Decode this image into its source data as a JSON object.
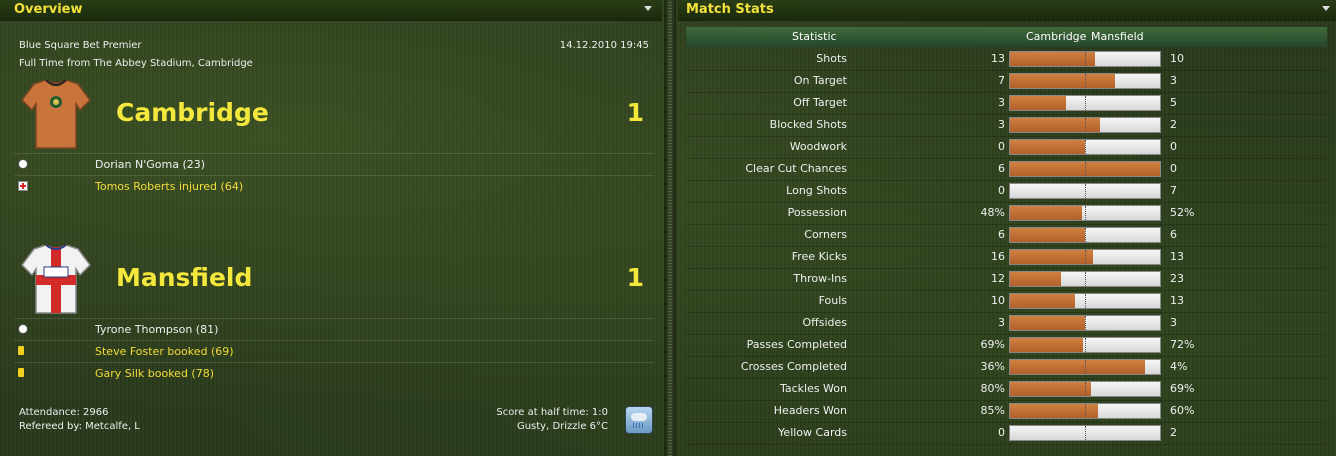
{
  "overview": {
    "title": "Overview",
    "competition": "Blue Square Bet Premier",
    "datetime": "14.12.2010 19:45",
    "subtitle": "Full Time from The Abbey Stadium, Cambridge",
    "home": {
      "name": "Cambridge",
      "score": "1",
      "shirt_color": "#c8743a",
      "events": [
        {
          "type": "goal",
          "text": "Dorian N'Goma (23)"
        },
        {
          "type": "injury",
          "text": "Tomos Roberts injured (64)"
        }
      ]
    },
    "away": {
      "name": "Mansfield",
      "score": "1",
      "shirt_color": "#f2f2f2",
      "events": [
        {
          "type": "goal",
          "text": "Tyrone Thompson (81)"
        },
        {
          "type": "yellow",
          "text": "Steve Foster booked (69)"
        },
        {
          "type": "yellow",
          "text": "Gary Silk booked (78)"
        }
      ]
    },
    "attendance": "Attendance: 2966",
    "referee": "Refereed by: Metcalfe, L",
    "half_time": "Score at half time: 1:0",
    "weather": "Gusty, Drizzle 6°C",
    "weather_icon": "drizzle-icon"
  },
  "stats": {
    "title": "Match Stats",
    "head_statistic": "Statistic",
    "head_home": "Cambridge",
    "head_away": "Mansfield",
    "colors": {
      "home": "#c06e34",
      "away": "#e6e6e6"
    },
    "rows": [
      {
        "label": "Shots",
        "home": "13",
        "away": "10",
        "home_share": 0.565
      },
      {
        "label": "On Target",
        "home": "7",
        "away": "3",
        "home_share": 0.7
      },
      {
        "label": "Off Target",
        "home": "3",
        "away": "5",
        "home_share": 0.375
      },
      {
        "label": "Blocked Shots",
        "home": "3",
        "away": "2",
        "home_share": 0.6
      },
      {
        "label": "Woodwork",
        "home": "0",
        "away": "0",
        "home_share": 0.5
      },
      {
        "label": "Clear Cut Chances",
        "home": "6",
        "away": "0",
        "home_share": 1.0
      },
      {
        "label": "Long Shots",
        "home": "0",
        "away": "7",
        "home_share": 0.0
      },
      {
        "label": "Possession",
        "home": "48%",
        "away": "52%",
        "home_share": 0.48
      },
      {
        "label": "Corners",
        "home": "6",
        "away": "6",
        "home_share": 0.5
      },
      {
        "label": "Free Kicks",
        "home": "16",
        "away": "13",
        "home_share": 0.552
      },
      {
        "label": "Throw-Ins",
        "home": "12",
        "away": "23",
        "home_share": 0.343
      },
      {
        "label": "Fouls",
        "home": "10",
        "away": "13",
        "home_share": 0.435
      },
      {
        "label": "Offsides",
        "home": "3",
        "away": "3",
        "home_share": 0.5
      },
      {
        "label": "Passes Completed",
        "home": "69%",
        "away": "72%",
        "home_share": 0.489
      },
      {
        "label": "Crosses Completed",
        "home": "36%",
        "away": "4%",
        "home_share": 0.9
      },
      {
        "label": "Tackles Won",
        "home": "80%",
        "away": "69%",
        "home_share": 0.537
      },
      {
        "label": "Headers Won",
        "home": "85%",
        "away": "60%",
        "home_share": 0.586
      },
      {
        "label": "Yellow Cards",
        "home": "0",
        "away": "2",
        "home_share": 0.0
      }
    ]
  }
}
